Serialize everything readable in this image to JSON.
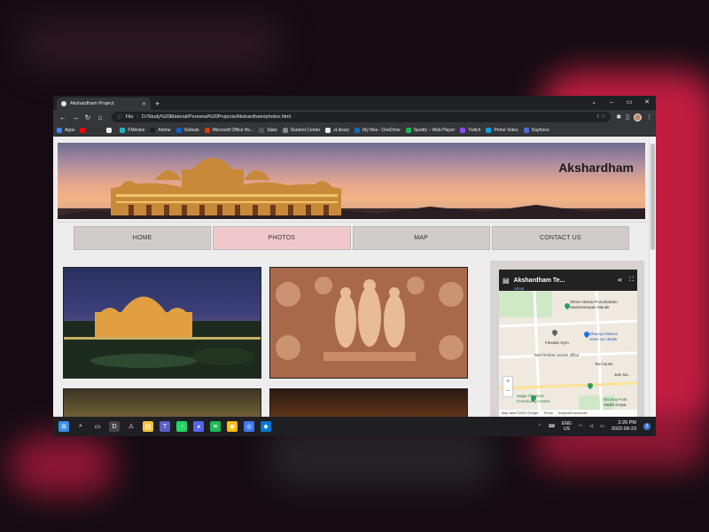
{
  "browser": {
    "tab_title": "Akshardham Project",
    "new_tab": "+",
    "address": "D:/Study%20Material/Personal%20Projects/Akshardham/photos.html",
    "address_prefix": "File",
    "window_controls": [
      "–",
      "▭",
      "✕"
    ]
  },
  "bookmarks": [
    {
      "label": "Apps",
      "color": "#4285f4"
    },
    {
      "label": "",
      "color": "#ff0000"
    },
    {
      "label": "",
      "color": "#333333"
    },
    {
      "label": "",
      "color": "#f1f1f1"
    },
    {
      "label": "FMovies",
      "color": "#1fb6c1"
    },
    {
      "label": "Anime",
      "color": "#222222"
    },
    {
      "label": "Outlook",
      "color": "#0a64d4"
    },
    {
      "label": "Microsoft Office Ho...",
      "color": "#d83b01"
    },
    {
      "label": "Slate",
      "color": "#555555"
    },
    {
      "label": "Student Center",
      "color": "#888888"
    },
    {
      "label": "zLibrary",
      "color": "#eeeeee"
    },
    {
      "label": "My files - OneDrive",
      "color": "#0f6cbd"
    },
    {
      "label": "Spotify – Web Player",
      "color": "#1db954"
    },
    {
      "label": "Twitch",
      "color": "#9146ff"
    },
    {
      "label": "Prime Video",
      "color": "#00a8e1"
    },
    {
      "label": "Dayforce",
      "color": "#4a6ee0"
    }
  ],
  "page": {
    "banner_title": "Akshardham",
    "nav": [
      "HOME",
      "PHOTOS",
      "MAP",
      "CONTACT US"
    ],
    "active_nav": "PHOTOS"
  },
  "map": {
    "title": "Akshardham Te...",
    "about": "About",
    "labels": [
      {
        "text": "Shree Akshar Purushottam",
        "cls": ""
      },
      {
        "text": "Swaminarayan Mandir",
        "cls": ""
      },
      {
        "text": "Fitreaks Gym",
        "cls": ""
      },
      {
        "text": "Shaurya Motors",
        "cls": "blue"
      },
      {
        "text": "Used car dealer",
        "cls": "blue"
      },
      {
        "text": "Mod keshav puram office",
        "cls": ""
      },
      {
        "text": "Tax house",
        "cls": ""
      },
      {
        "text": "Jain Sa...",
        "cls": ""
      },
      {
        "text": "Sagar Pleasure",
        "cls": "green"
      },
      {
        "text": "Community Centre",
        "cls": "green"
      },
      {
        "text": "Nischay Park",
        "cls": "green"
      },
      {
        "text": "Vadini Krupa",
        "cls": ""
      }
    ],
    "footer": [
      "Map data ©2022 Google",
      "Terms",
      "Keyboard shortcuts"
    ]
  },
  "taskbar": {
    "lang_line1": "ENG",
    "lang_line2": "US",
    "time": "2:20 PM",
    "date": "2022-09-23",
    "notification_count": "3",
    "apps": [
      {
        "name": "start-icon",
        "color": "#3a8ee6",
        "glyph": "⊞"
      },
      {
        "name": "search-icon",
        "color": "transparent",
        "glyph": "⌕"
      },
      {
        "name": "task-view-icon",
        "color": "transparent",
        "glyph": "▭"
      },
      {
        "name": "dell-icon",
        "color": "#444",
        "glyph": "D"
      },
      {
        "name": "warning-icon",
        "color": "transparent",
        "glyph": "⚠"
      },
      {
        "name": "file-explorer-icon",
        "color": "#f4c542",
        "glyph": "▤"
      },
      {
        "name": "teams-icon",
        "color": "#5b5fc7",
        "glyph": "T"
      },
      {
        "name": "whatsapp-icon",
        "color": "#25d366",
        "glyph": "◔"
      },
      {
        "name": "discord-icon",
        "color": "#5865f2",
        "glyph": "◕"
      },
      {
        "name": "spotify-icon",
        "color": "#1db954",
        "glyph": "≋"
      },
      {
        "name": "chrome-icon",
        "color": "#fbbc05",
        "glyph": "◉"
      },
      {
        "name": "signal-icon",
        "color": "#3a76f0",
        "glyph": "◎"
      },
      {
        "name": "vscode-icon",
        "color": "#0078d4",
        "glyph": "◆"
      }
    ]
  }
}
